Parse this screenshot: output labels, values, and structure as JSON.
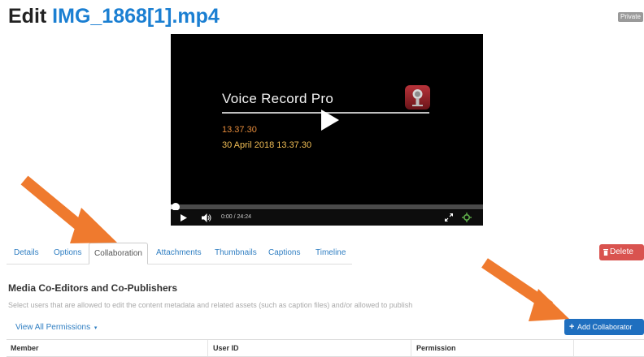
{
  "page": {
    "title_prefix": "Edit ",
    "media_name": "IMG_1868[1].mp4",
    "privacy_badge": "Private"
  },
  "video": {
    "overlay_title": "Voice Record Pro",
    "overlay_time": "13.37.30",
    "overlay_date": "30 April 2018 13.37.30",
    "elapsed": "0:00",
    "separator": "/",
    "duration": "24:24",
    "progress_fraction": 0.01
  },
  "tabs": [
    {
      "label": "Details"
    },
    {
      "label": "Options"
    },
    {
      "label": "Collaboration",
      "active": true
    },
    {
      "label": "Attachments"
    },
    {
      "label": "Thumbnails"
    },
    {
      "label": "Captions"
    },
    {
      "label": "Timeline"
    }
  ],
  "actions": {
    "delete_label": "Delete",
    "add_collaborator_plus": "+",
    "add_collaborator_label": "Add Collaborator"
  },
  "collaboration": {
    "heading": "Media Co-Editors and Co-Publishers",
    "description": "Select users that are allowed to edit the content metadata and related assets (such as caption files) and/or allowed to publish",
    "view_permissions_label": "View All Permissions",
    "view_permissions_caret": "▾",
    "columns": [
      "Member",
      "User ID",
      "Permission",
      ""
    ]
  },
  "icons": {
    "app_icon": "microphone-app-icon",
    "play": "play-icon",
    "volume": "volume-icon",
    "fullscreen": "fullscreen-icon",
    "settings": "settings-icon",
    "trash": "trash-icon"
  },
  "colors": {
    "link": "#2f7ec2",
    "title_accent": "#1b7fd2",
    "delete": "#d9534f",
    "primary": "#1f6fbf",
    "annotation_arrow": "#ef7a2e"
  }
}
